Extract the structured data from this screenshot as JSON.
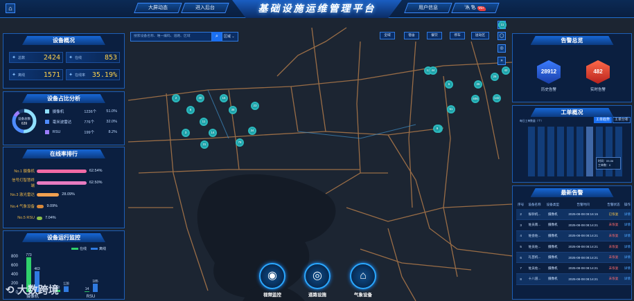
{
  "header": {
    "home_icon": "home-icon",
    "nav_left": [
      "大屏动态",
      "进入后台"
    ],
    "title": "基础设施运维管理平台",
    "nav_right": [
      "用户信息",
      "消 息"
    ],
    "message_badge": "99+"
  },
  "device_overview": {
    "title": "设备概况",
    "stats": [
      {
        "label": "总数",
        "value": "2424"
      },
      {
        "label": "在线",
        "value": "853"
      },
      {
        "label": "离线",
        "value": "1571"
      },
      {
        "label": "在线率",
        "value": "35.19%"
      }
    ]
  },
  "device_share": {
    "title": "设备占比分析",
    "donut_label": "设备总数",
    "donut_value": "639",
    "items": [
      {
        "name": "摄像机",
        "count": "1236个",
        "percent": "51.0%",
        "color": "#8fe0ff"
      },
      {
        "name": "毫米波雷达",
        "count": "776个",
        "percent": "32.0%",
        "color": "#4f8cff"
      },
      {
        "name": "RSU",
        "count": "199个",
        "percent": "8.2%",
        "color": "#9b7dff"
      }
    ]
  },
  "online_rank": {
    "title": "在线率排行",
    "rows": [
      {
        "rank": "No.1 摄像机",
        "value": "62.54%",
        "pct": 62.54,
        "color": "#f06aa5"
      },
      {
        "rank": "信号灯智慧终端",
        "value": "62.50%",
        "pct": 62.5,
        "color": "#e87bc0"
      },
      {
        "rank": "No.3 激光雷达",
        "value": "28.09%",
        "pct": 28.09,
        "color": "#f0a050"
      },
      {
        "rank": "No.4 气象设备",
        "value": "9.09%",
        "pct": 9.09,
        "color": "#d8883a"
      },
      {
        "rank": "No.5 RSU",
        "value": "7.04%",
        "pct": 7.04,
        "color": "#8bbf4a"
      }
    ]
  },
  "device_monitor": {
    "title": "设备运行监控",
    "legend": [
      "在线",
      "离线"
    ],
    "yticks": [
      "800",
      "600",
      "400",
      "200",
      "0"
    ]
  },
  "chart_data": [
    {
      "type": "bar",
      "title": "设备运行监控",
      "categories": [
        "摄像机",
        "",
        "RSU"
      ],
      "series": [
        {
          "name": "在线",
          "values": [
            773,
            50,
            14
          ]
        },
        {
          "name": "离线",
          "values": [
            463,
            128,
            185
          ]
        }
      ],
      "ylim": [
        0,
        800
      ]
    }
  ],
  "map": {
    "search_placeholder": "搜索设备名称、唯一编码、道路、区域",
    "search_icon": "search-icon",
    "region_label": "区域",
    "layer_buttons": [
      "全域",
      "宿舍",
      "餐饮",
      "停车",
      "送动区"
    ],
    "clusters": [
      "11",
      "42",
      "12",
      "26",
      "6",
      "2",
      "40",
      "15",
      "23",
      "6",
      "38",
      "11",
      "34",
      "3",
      "14",
      "78",
      "31",
      "406",
      "51",
      "142",
      "26",
      "116",
      "44",
      "9"
    ]
  },
  "map_tools": [
    "11",
    "◯",
    "◎",
    "»"
  ],
  "bottom_nav": [
    {
      "label": "视频监控",
      "icon": "camera-icon"
    },
    {
      "label": "道路设施",
      "icon": "radar-icon"
    },
    {
      "label": "气象设备",
      "icon": "weather-station-icon"
    }
  ],
  "alarm_overview": {
    "title": "告警总览",
    "history_value": "28912",
    "history_label": "历史告警",
    "realtime_value": "482",
    "realtime_label": "实时告警"
  },
  "work_orders": {
    "title": "工单概况",
    "tabs": [
      "工单趋势",
      "工单分析"
    ],
    "tooltip_line1": "时间：09-06",
    "tooltip_line2": "工单数：0",
    "y_caption": "每日工单数量（个）"
  },
  "latest_alarms": {
    "title": "最新告警",
    "columns": [
      "序号",
      "设备名称",
      "设备类型",
      "告警时间",
      "告警状态",
      "操作"
    ],
    "rows": [
      [
        "2",
        "振铃机...",
        "摄像机",
        "2025-08-08 09:16:15",
        "已恢复",
        "详情"
      ],
      [
        "3",
        "佐员南...",
        "摄像机",
        "2025-08-08 08:14:21",
        "未恢复",
        "详情"
      ],
      [
        "4",
        "佐会佐...",
        "摄像机",
        "2025-08-08 08:14:21",
        "未恢复",
        "详情"
      ],
      [
        "5",
        "佐员佐...",
        "摄像机",
        "2025-08-08 08:14:21",
        "未恢复",
        "详情"
      ],
      [
        "6",
        "礼芸机...",
        "摄像机",
        "2025-08-08 08:14:21",
        "未恢复",
        "详情"
      ],
      [
        "7",
        "佐员佐...",
        "摄像机",
        "2025-08-08 08:14:21",
        "未恢复",
        "详情"
      ],
      [
        "8",
        "十八道...",
        "摄像机",
        "2025-08-08 08:14:21",
        "未恢复",
        "详情"
      ]
    ]
  },
  "watermark": "大数跨境"
}
